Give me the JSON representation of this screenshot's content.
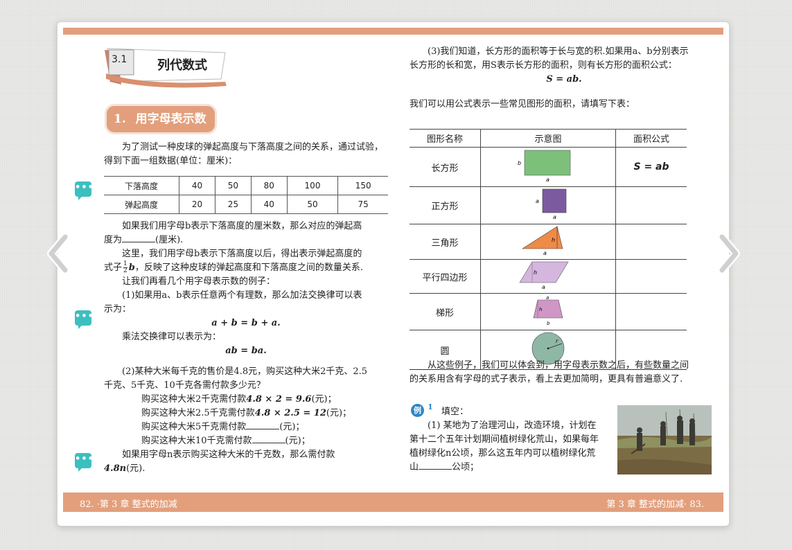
{
  "section": {
    "number": "3.1",
    "title": "列代数式"
  },
  "subsection": {
    "number": "1.",
    "title": "用字母表示数"
  },
  "left": {
    "intro": "为了测试一种皮球的弹起高度与下落高度之间的关系，通过试验，得到下面一组数据(单位：厘米)：",
    "table": {
      "rows": [
        {
          "label": "下落高度",
          "values": [
            "40",
            "50",
            "80",
            "100",
            "150"
          ]
        },
        {
          "label": "弹起高度",
          "values": [
            "20",
            "25",
            "40",
            "50",
            "75"
          ]
        }
      ]
    },
    "p1a": "如果我们用字母b表示下落高度的厘米数，那么对应的弹起高",
    "p1b_pre": "度为",
    "p1b_post": "(厘米).",
    "p2a": "这里，我们用字母b表示下落高度以后，得出表示弹起高度的",
    "p2b_pre": "式子",
    "p2b_frac_num": "1",
    "p2b_frac_den": "2",
    "p2b_var": "b",
    "p2b_post": "，反映了这种皮球的弹起高度和下落高度之间的数量关系.",
    "p3": "让我们再看几个用字母表示数的例子：",
    "p4a": "(1)如果用a、b表示任意两个有理数，那么加法交换律可以表",
    "p4b": "示为：",
    "formula1": "a + b = b + a.",
    "p5": "乘法交换律可以表示为：",
    "formula2": "ab = ba.",
    "p6a": "(2)某种大米每千克的售价是4.8元，购买这种大米2千克、2.5",
    "p6b": "千克、5千克、10千克各需付款多少元？",
    "l1_pre": "购买这种大米2千克需付款",
    "l1_math": "4.8 × 2 = 9.6",
    "l1_post": "(元)；",
    "l2_pre": "购买这种大米2.5千克需付款",
    "l2_math": "4.8 × 2.5 = 12",
    "l2_post": "(元)；",
    "l3_pre": "购买这种大米5千克需付款",
    "l3_post": "(元)；",
    "l4_pre": "购买这种大米10千克需付款",
    "l4_post": "(元)；",
    "p7a": "如果用字母n表示购买这种大米的千克数，那么需付款",
    "p7b_math": "4.8n",
    "p7b_post": "(元)."
  },
  "right": {
    "p1a": "(3)我们知道，长方形的面积等于长与宽的积.如果用a、b分别表示",
    "p1b": "长方形的长和宽，用S表示长方形的面积，则有长方形的面积公式：",
    "formula": "S = ab.",
    "p2": "我们可以用公式表示一些常见图形的面积，请填写下表：",
    "table": {
      "headers": [
        "图形名称",
        "示意图",
        "面积公式"
      ],
      "rows": [
        {
          "name": "长方形",
          "formula": "S = ab"
        },
        {
          "name": "正方形",
          "formula": ""
        },
        {
          "name": "三角形",
          "formula": ""
        },
        {
          "name": "平行四边形",
          "formula": ""
        },
        {
          "name": "梯形",
          "formula": ""
        },
        {
          "name": "圆",
          "formula": ""
        }
      ],
      "labels": {
        "a": "a",
        "b": "b",
        "h": "h",
        "r": "r"
      }
    },
    "p3a": "从这些例子，我们可以体会到，用字母表示数之后，有些数量之间",
    "p3b": "的关系用含有字母的式子表示，看上去更加简明，更具有普遍意义了.",
    "example_badge": "例",
    "example_num": "1",
    "example_title": "填空：",
    "ex1": "(1) 某地为了治理河山，改造环境，计划在",
    "ex2": "第十二个五年计划期间植树绿化荒山，如果每年",
    "ex3": "植树绿化n公顷，那么这五年内可以植树绿化荒",
    "ex4_pre": "山",
    "ex4_post": "公顷；"
  },
  "footer": {
    "left": "82.  ·第 3 章 整式的加减",
    "right": "第 3 章 整式的加减·  83."
  },
  "comment_glyph": "•••",
  "colors": {
    "accent": "#e39f7c",
    "comment": "#3cbfbf",
    "rect": "#7dc07a",
    "square": "#7b5aa0",
    "triangle": "#ef8a47",
    "lilac": "#d4b6de",
    "circle": "#8fb7a6"
  }
}
